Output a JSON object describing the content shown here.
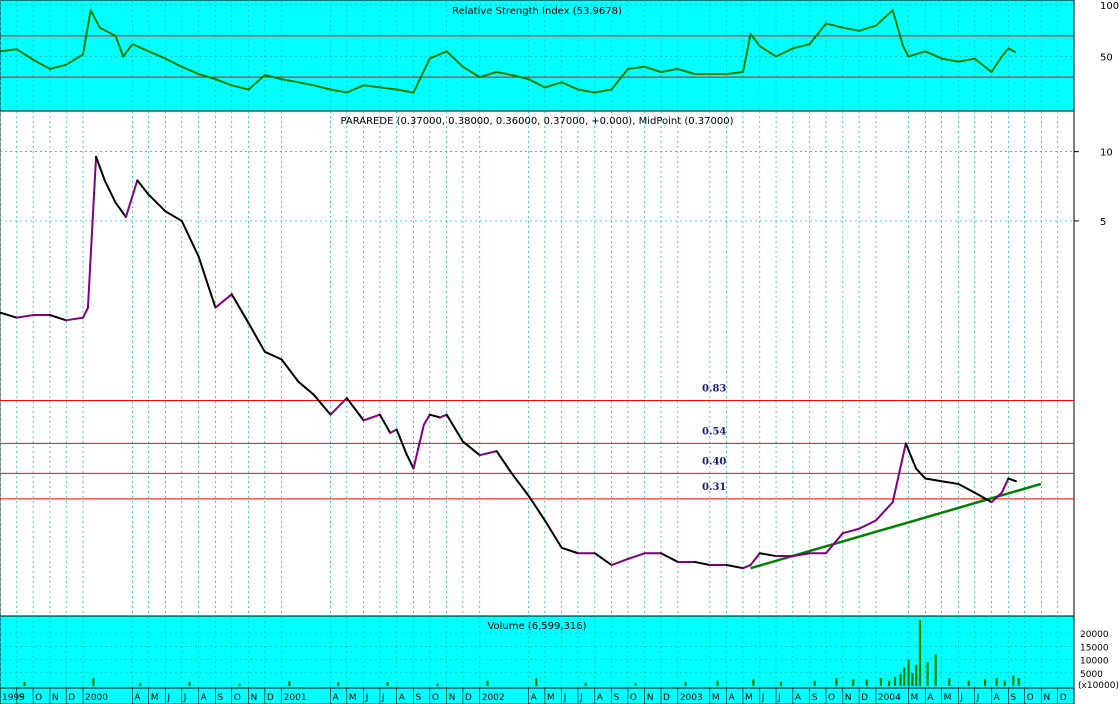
{
  "chart_data": [
    {
      "type": "line",
      "title": "Relative Strength Index (53.9678)",
      "ylim": [
        0,
        100
      ],
      "y_ticks": [
        "100",
        "50"
      ],
      "y_tick_values": [
        100,
        50
      ],
      "reference_lines": [
        70,
        30
      ],
      "series": [
        {
          "color": "#008000",
          "x": [
            "1999-08-01",
            "1999-09-01",
            "1999-10-01",
            "1999-11-01",
            "1999-12-01",
            "2000-01-01",
            "2000-01-15",
            "2000-02-01",
            "2000-03-01",
            "2000-03-15",
            "2000-04-01",
            "2000-05-01",
            "2000-06-01",
            "2000-07-01",
            "2000-08-01",
            "2000-09-01",
            "2000-10-01",
            "2000-11-01",
            "2000-12-01",
            "2001-01-01",
            "2001-02-01",
            "2001-03-01",
            "2001-04-01",
            "2001-05-01",
            "2001-06-01",
            "2001-07-01",
            "2001-08-01",
            "2001-09-01",
            "2001-10-01",
            "2001-11-01",
            "2001-12-01",
            "2002-01-01",
            "2002-02-01",
            "2002-03-01",
            "2002-04-01",
            "2002-05-01",
            "2002-06-01",
            "2002-07-01",
            "2002-08-01",
            "2002-09-01",
            "2002-10-01",
            "2002-11-01",
            "2002-12-01",
            "2003-01-01",
            "2003-02-01",
            "2003-03-01",
            "2003-04-01",
            "2003-05-01",
            "2003-05-15",
            "2003-06-01",
            "2003-07-01",
            "2003-08-01",
            "2003-09-01",
            "2003-10-01",
            "2003-11-01",
            "2003-12-01",
            "2004-01-01",
            "2004-02-01",
            "2004-02-20",
            "2004-03-01",
            "2004-04-01",
            "2004-05-01",
            "2004-06-01",
            "2004-07-01",
            "2004-08-01",
            "2004-08-20",
            "2004-09-01",
            "2004-09-15"
          ],
          "values": [
            55,
            57,
            47,
            38,
            42,
            52,
            95,
            78,
            70,
            50,
            62,
            55,
            48,
            40,
            33,
            28,
            22,
            18,
            32,
            28,
            25,
            22,
            18,
            15,
            22,
            20,
            18,
            15,
            48,
            55,
            40,
            30,
            35,
            32,
            28,
            20,
            25,
            18,
            15,
            18,
            38,
            40,
            35,
            38,
            33,
            33,
            33,
            35,
            72,
            60,
            50,
            58,
            62,
            82,
            78,
            75,
            80,
            95,
            60,
            50,
            55,
            48,
            45,
            48,
            35,
            50,
            58,
            54
          ]
        }
      ]
    },
    {
      "type": "line",
      "title": "PARAREDE (0.37000, 0.38000, 0.36000, 0.37000, +0.000), MidPoint (0.37000)",
      "y_scale": "log",
      "y_ticks": [
        "10",
        "5"
      ],
      "y_tick_values": [
        10,
        5
      ],
      "reference_lines": [
        {
          "label": "0.83",
          "value": 0.83,
          "color": "#ff0000"
        },
        {
          "label": "0.54",
          "value": 0.54,
          "color": "#ff0000"
        },
        {
          "label": "0.40",
          "value": 0.4,
          "color": "#ff0000"
        },
        {
          "label": "0.31",
          "value": 0.31,
          "color": "#ff0000"
        }
      ],
      "trendline": {
        "color": "#008000",
        "x": [
          "2003-05-15",
          "2004-10-31"
        ],
        "y": [
          0.155,
          0.36
        ]
      },
      "series": [
        {
          "colors": [
            "#000000",
            "#800080"
          ],
          "x": [
            "1999-08-01",
            "1999-09-01",
            "1999-10-01",
            "1999-11-01",
            "1999-12-01",
            "2000-01-01",
            "2000-01-10",
            "2000-01-25",
            "2000-02-10",
            "2000-03-01",
            "2000-03-20",
            "2000-04-10",
            "2000-05-01",
            "2000-06-01",
            "2000-07-01",
            "2000-08-01",
            "2000-09-01",
            "2000-10-01",
            "2000-11-01",
            "2000-12-01",
            "2001-01-01",
            "2001-02-01",
            "2001-03-01",
            "2001-04-01",
            "2001-05-01",
            "2001-06-01",
            "2001-07-01",
            "2001-07-20",
            "2001-08-01",
            "2001-08-20",
            "2001-09-01",
            "2001-09-20",
            "2001-10-01",
            "2001-10-20",
            "2001-11-01",
            "2001-12-01",
            "2002-01-01",
            "2002-02-01",
            "2002-03-01",
            "2002-04-01",
            "2002-05-01",
            "2002-06-01",
            "2002-07-01",
            "2002-08-01",
            "2002-09-01",
            "2002-10-01",
            "2002-11-01",
            "2002-12-01",
            "2003-01-01",
            "2003-02-01",
            "2003-03-01",
            "2003-04-01",
            "2003-05-01",
            "2003-05-15",
            "2003-06-01",
            "2003-07-01",
            "2003-08-01",
            "2003-09-01",
            "2003-10-01",
            "2003-11-01",
            "2003-12-01",
            "2004-01-01",
            "2004-02-01",
            "2004-02-25",
            "2004-03-15",
            "2004-04-01",
            "2004-05-01",
            "2004-06-01",
            "2004-07-01",
            "2004-08-01",
            "2004-08-20",
            "2004-09-01",
            "2004-09-15"
          ],
          "values": [
            2.0,
            1.9,
            1.95,
            1.95,
            1.85,
            1.9,
            2.1,
            9.5,
            7.5,
            6.0,
            5.2,
            7.5,
            6.5,
            5.5,
            5.0,
            3.5,
            2.1,
            2.4,
            1.8,
            1.35,
            1.25,
            1.0,
            0.88,
            0.72,
            0.85,
            0.68,
            0.72,
            0.6,
            0.62,
            0.48,
            0.42,
            0.65,
            0.72,
            0.7,
            0.72,
            0.55,
            0.48,
            0.5,
            0.4,
            0.32,
            0.25,
            0.19,
            0.18,
            0.18,
            0.16,
            0.17,
            0.18,
            0.18,
            0.165,
            0.165,
            0.16,
            0.16,
            0.155,
            0.16,
            0.18,
            0.175,
            0.175,
            0.18,
            0.18,
            0.22,
            0.23,
            0.25,
            0.3,
            0.54,
            0.42,
            0.38,
            0.37,
            0.36,
            0.33,
            0.3,
            0.33,
            0.38,
            0.37
          ]
        }
      ]
    },
    {
      "type": "bar",
      "title": "Volume (6,599,316)",
      "y_axis_unit": "(x10000)",
      "y_ticks": [
        "20000",
        "15000",
        "10000",
        "5000"
      ],
      "y_tick_values": [
        20000,
        15000,
        10000,
        5000
      ],
      "ylim": [
        0,
        25000
      ],
      "color": "#008000",
      "x": [
        "1999-09-15",
        "2000-01-20",
        "2000-04-15",
        "2000-07-15",
        "2000-10-15",
        "2001-01-15",
        "2001-04-15",
        "2001-07-15",
        "2001-10-15",
        "2002-01-15",
        "2002-04-15",
        "2002-07-15",
        "2002-10-15",
        "2003-01-15",
        "2003-03-15",
        "2003-05-20",
        "2003-07-10",
        "2003-09-10",
        "2003-10-20",
        "2003-11-20",
        "2003-12-15",
        "2004-01-10",
        "2004-01-25",
        "2004-02-05",
        "2004-02-15",
        "2004-02-22",
        "2004-03-01",
        "2004-03-08",
        "2004-03-15",
        "2004-03-22",
        "2004-04-05",
        "2004-04-20",
        "2004-05-15",
        "2004-06-20",
        "2004-07-20",
        "2004-08-10",
        "2004-08-25",
        "2004-09-10",
        "2004-09-20"
      ],
      "values": [
        1500,
        3000,
        1200,
        1500,
        900,
        1800,
        1400,
        1500,
        1000,
        2000,
        3000,
        1300,
        1200,
        1500,
        2000,
        2500,
        1600,
        2000,
        3000,
        2500,
        2500,
        3000,
        2000,
        3500,
        4500,
        7000,
        10000,
        5000,
        8000,
        25000,
        9000,
        12000,
        3000,
        2000,
        2500,
        3000,
        2000,
        4000,
        3000
      ]
    }
  ],
  "x_axis": {
    "labels": [
      {
        "d": "1999-08-01",
        "t": "1999"
      },
      {
        "d": "1999-09-01",
        "t": "S"
      },
      {
        "d": "1999-10-01",
        "t": "O"
      },
      {
        "d": "1999-11-01",
        "t": "N"
      },
      {
        "d": "1999-12-01",
        "t": "D"
      },
      {
        "d": "2000-01-01",
        "t": "2000"
      },
      {
        "d": "2000-04-01",
        "t": "A"
      },
      {
        "d": "2000-05-01",
        "t": "M"
      },
      {
        "d": "2000-06-01",
        "t": "J"
      },
      {
        "d": "2000-07-01",
        "t": "J"
      },
      {
        "d": "2000-08-01",
        "t": "A"
      },
      {
        "d": "2000-09-01",
        "t": "S"
      },
      {
        "d": "2000-10-01",
        "t": "O"
      },
      {
        "d": "2000-11-01",
        "t": "N"
      },
      {
        "d": "2000-12-01",
        "t": "D"
      },
      {
        "d": "2001-01-01",
        "t": "2001"
      },
      {
        "d": "2001-04-01",
        "t": "A"
      },
      {
        "d": "2001-05-01",
        "t": "M"
      },
      {
        "d": "2001-06-01",
        "t": "J"
      },
      {
        "d": "2001-07-01",
        "t": "J"
      },
      {
        "d": "2001-08-01",
        "t": "A"
      },
      {
        "d": "2001-09-01",
        "t": "S"
      },
      {
        "d": "2001-10-01",
        "t": "O"
      },
      {
        "d": "2001-11-01",
        "t": "N"
      },
      {
        "d": "2001-12-01",
        "t": "D"
      },
      {
        "d": "2002-01-01",
        "t": "2002"
      },
      {
        "d": "2002-04-01",
        "t": "A"
      },
      {
        "d": "2002-05-01",
        "t": "M"
      },
      {
        "d": "2002-06-01",
        "t": "J"
      },
      {
        "d": "2002-07-01",
        "t": "J"
      },
      {
        "d": "2002-08-01",
        "t": "A"
      },
      {
        "d": "2002-09-01",
        "t": "S"
      },
      {
        "d": "2002-10-01",
        "t": "O"
      },
      {
        "d": "2002-11-01",
        "t": "N"
      },
      {
        "d": "2002-12-01",
        "t": "D"
      },
      {
        "d": "2003-01-01",
        "t": "2003"
      },
      {
        "d": "2003-03-01",
        "t": "M"
      },
      {
        "d": "2003-04-01",
        "t": "A"
      },
      {
        "d": "2003-05-01",
        "t": "M"
      },
      {
        "d": "2003-06-01",
        "t": "J"
      },
      {
        "d": "2003-07-01",
        "t": "J"
      },
      {
        "d": "2003-08-01",
        "t": "A"
      },
      {
        "d": "2003-09-01",
        "t": "S"
      },
      {
        "d": "2003-10-01",
        "t": "O"
      },
      {
        "d": "2003-11-01",
        "t": "N"
      },
      {
        "d": "2003-12-01",
        "t": "D"
      },
      {
        "d": "2004-01-01",
        "t": "2004"
      },
      {
        "d": "2004-03-01",
        "t": "M"
      },
      {
        "d": "2004-04-01",
        "t": "A"
      },
      {
        "d": "2004-05-01",
        "t": "M"
      },
      {
        "d": "2004-06-01",
        "t": "J"
      },
      {
        "d": "2004-07-01",
        "t": "J"
      },
      {
        "d": "2004-08-01",
        "t": "A"
      },
      {
        "d": "2004-09-01",
        "t": "S"
      },
      {
        "d": "2004-10-01",
        "t": "O"
      },
      {
        "d": "2004-11-01",
        "t": "N"
      },
      {
        "d": "2004-12-01",
        "t": "D"
      }
    ],
    "range": [
      "1999-08-01",
      "2004-12-31"
    ]
  },
  "colors": {
    "panel_bg": "#00ffff",
    "grid": "#00b4b4",
    "reference": "#ff0000",
    "rsi_line": "#008000",
    "trendline": "#008000",
    "price_down": "#000000",
    "price_up": "#800080",
    "volume": "#008000",
    "fib_label": "#1a1a80"
  }
}
